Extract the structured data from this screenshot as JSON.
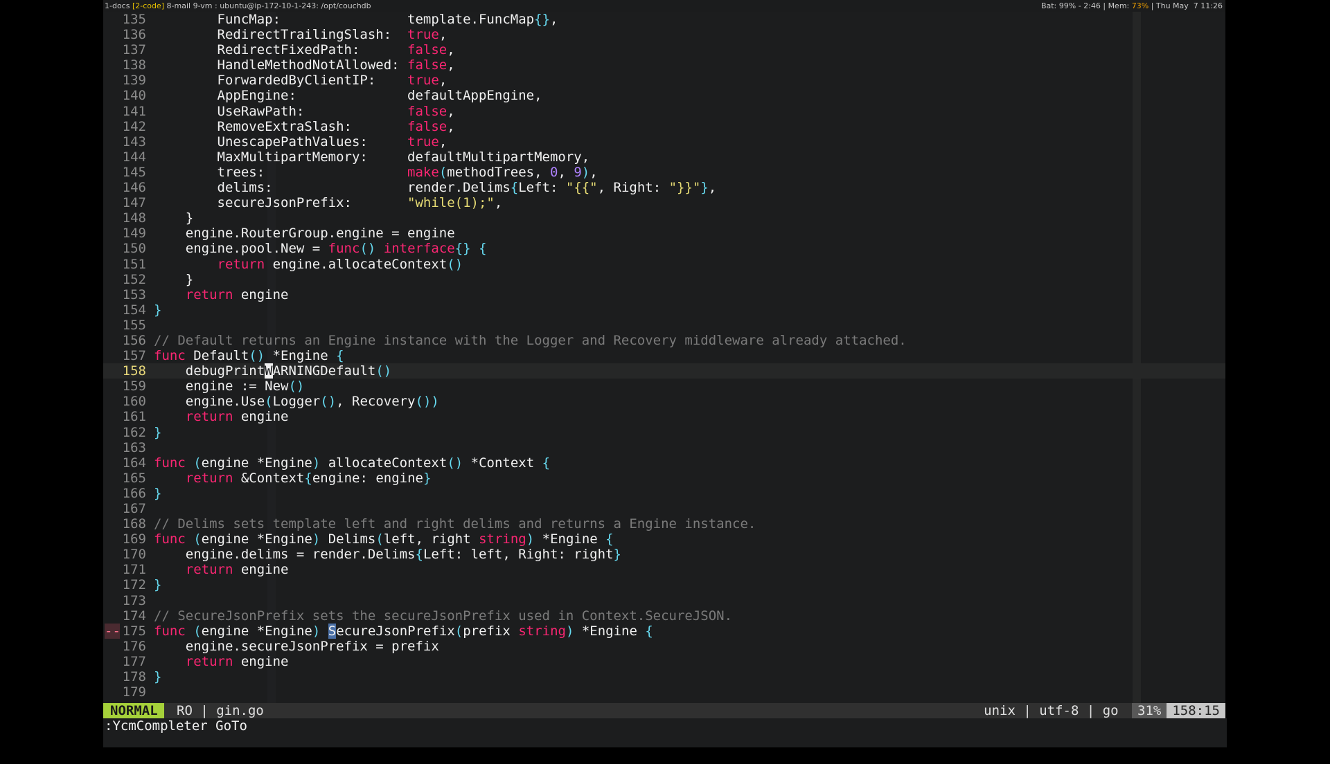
{
  "topbar": {
    "windows_prefix": "1-docs ",
    "active_window": "[2-code]",
    "windows_suffix": " 8-mail 9-vm : ubuntu@ip-172-10-1-243: /opt/couchdb",
    "bat_label": "Bat: 99% - 2:46 | Mem: ",
    "mem_value": "73%",
    "datetime": " | Thu May  7 11:26"
  },
  "editor": {
    "cursor_line": "158",
    "lines": [
      {
        "n": "135",
        "t": [
          [
            "        FuncMap:                ",
            ""
          ],
          [
            "template.FuncMap",
            ""
          ],
          [
            "{}",
            "br"
          ],
          [
            ",",
            ""
          ]
        ]
      },
      {
        "n": "136",
        "t": [
          [
            "        RedirectTrailingSlash:  ",
            ""
          ],
          [
            "true",
            "kw"
          ],
          [
            ",",
            ""
          ]
        ]
      },
      {
        "n": "137",
        "t": [
          [
            "        RedirectFixedPath:      ",
            ""
          ],
          [
            "false",
            "kw"
          ],
          [
            ",",
            ""
          ]
        ]
      },
      {
        "n": "138",
        "t": [
          [
            "        HandleMethodNotAllowed: ",
            ""
          ],
          [
            "false",
            "kw"
          ],
          [
            ",",
            ""
          ]
        ]
      },
      {
        "n": "139",
        "t": [
          [
            "        ForwardedByClientIP:    ",
            ""
          ],
          [
            "true",
            "kw"
          ],
          [
            ",",
            ""
          ]
        ]
      },
      {
        "n": "140",
        "t": [
          [
            "        AppEngine:              defaultAppEngine,",
            ""
          ]
        ]
      },
      {
        "n": "141",
        "t": [
          [
            "        UseRawPath:             ",
            ""
          ],
          [
            "false",
            "kw"
          ],
          [
            ",",
            ""
          ]
        ]
      },
      {
        "n": "142",
        "t": [
          [
            "        RemoveExtraSlash:       ",
            ""
          ],
          [
            "false",
            "kw"
          ],
          [
            ",",
            ""
          ]
        ]
      },
      {
        "n": "143",
        "t": [
          [
            "        UnescapePathValues:     ",
            ""
          ],
          [
            "true",
            "kw"
          ],
          [
            ",",
            ""
          ]
        ]
      },
      {
        "n": "144",
        "t": [
          [
            "        MaxMultipartMemory:     defaultMultipartMemory,",
            ""
          ]
        ]
      },
      {
        "n": "145",
        "t": [
          [
            "        trees:                  ",
            ""
          ],
          [
            "make",
            "kw"
          ],
          [
            "(",
            "br"
          ],
          [
            "methodTrees, ",
            ""
          ],
          [
            "0",
            "num"
          ],
          [
            ", ",
            ""
          ],
          [
            "9",
            "num"
          ],
          [
            ")",
            "br"
          ],
          [
            ",",
            ""
          ]
        ]
      },
      {
        "n": "146",
        "t": [
          [
            "        delims:                 render.Delims",
            ""
          ],
          [
            "{",
            "br"
          ],
          [
            "Left: ",
            ""
          ],
          [
            "\"{{\"",
            "str"
          ],
          [
            ", Right: ",
            ""
          ],
          [
            "\"}}\"",
            "str"
          ],
          [
            "}",
            "br"
          ],
          [
            ",",
            ""
          ]
        ]
      },
      {
        "n": "147",
        "t": [
          [
            "        secureJsonPrefix:       ",
            ""
          ],
          [
            "\"while(1);\"",
            "str"
          ],
          [
            ",",
            ""
          ]
        ]
      },
      {
        "n": "148",
        "t": [
          [
            "    }",
            ""
          ]
        ]
      },
      {
        "n": "149",
        "t": [
          [
            "    engine.RouterGroup.engine = engine",
            ""
          ]
        ]
      },
      {
        "n": "150",
        "t": [
          [
            "    engine.pool.New = ",
            ""
          ],
          [
            "func",
            "kw"
          ],
          [
            "()",
            "br"
          ],
          [
            " ",
            ""
          ],
          [
            "interface",
            "kw"
          ],
          [
            "{}",
            "br"
          ],
          [
            " ",
            ""
          ],
          [
            "{",
            "br"
          ]
        ]
      },
      {
        "n": "151",
        "t": [
          [
            "        ",
            ""
          ],
          [
            "return",
            "kw"
          ],
          [
            " engine.allocateContext",
            ""
          ],
          [
            "()",
            "br"
          ]
        ]
      },
      {
        "n": "152",
        "t": [
          [
            "    }",
            ""
          ]
        ]
      },
      {
        "n": "153",
        "t": [
          [
            "    ",
            ""
          ],
          [
            "return",
            "kw"
          ],
          [
            " engine",
            ""
          ]
        ]
      },
      {
        "n": "154",
        "t": [
          [
            "}",
            "br"
          ]
        ]
      },
      {
        "n": "155",
        "t": []
      },
      {
        "n": "156",
        "t": [
          [
            "// Default returns an Engine instance with the Logger and Recovery middleware already attached.",
            "cm"
          ]
        ]
      },
      {
        "n": "157",
        "t": [
          [
            "func",
            "kw"
          ],
          [
            " Default",
            ""
          ],
          [
            "()",
            "br"
          ],
          [
            " *Engine ",
            ""
          ],
          [
            "{",
            "br"
          ]
        ]
      },
      {
        "n": "158",
        "t": [
          [
            "    debugPrint",
            ""
          ],
          [
            "W",
            "cur"
          ],
          [
            "ARNINGDefault",
            ""
          ],
          [
            "()",
            "br"
          ]
        ]
      },
      {
        "n": "159",
        "t": [
          [
            "    engine := New",
            ""
          ],
          [
            "()",
            "br"
          ]
        ]
      },
      {
        "n": "160",
        "t": [
          [
            "    engine.Use",
            ""
          ],
          [
            "(",
            "br"
          ],
          [
            "Logger",
            ""
          ],
          [
            "()",
            "br"
          ],
          [
            ", Recovery",
            ""
          ],
          [
            "())",
            "br"
          ]
        ]
      },
      {
        "n": "161",
        "t": [
          [
            "    ",
            ""
          ],
          [
            "return",
            "kw"
          ],
          [
            " engine",
            ""
          ]
        ]
      },
      {
        "n": "162",
        "t": [
          [
            "}",
            "br"
          ]
        ]
      },
      {
        "n": "163",
        "t": []
      },
      {
        "n": "164",
        "t": [
          [
            "func",
            "kw"
          ],
          [
            " ",
            ""
          ],
          [
            "(",
            "br"
          ],
          [
            "engine *Engine",
            ""
          ],
          [
            ")",
            "br"
          ],
          [
            " allocateContext",
            ""
          ],
          [
            "()",
            "br"
          ],
          [
            " *Context ",
            ""
          ],
          [
            "{",
            "br"
          ]
        ]
      },
      {
        "n": "165",
        "t": [
          [
            "    ",
            ""
          ],
          [
            "return",
            "kw"
          ],
          [
            " &Context",
            ""
          ],
          [
            "{",
            "br"
          ],
          [
            "engine: engine",
            ""
          ],
          [
            "}",
            "br"
          ]
        ]
      },
      {
        "n": "166",
        "t": [
          [
            "}",
            "br"
          ]
        ]
      },
      {
        "n": "167",
        "t": []
      },
      {
        "n": "168",
        "t": [
          [
            "// Delims sets template left and right delims and returns a Engine instance.",
            "cm"
          ]
        ]
      },
      {
        "n": "169",
        "t": [
          [
            "func",
            "kw"
          ],
          [
            " ",
            ""
          ],
          [
            "(",
            "br"
          ],
          [
            "engine *Engine",
            ""
          ],
          [
            ")",
            "br"
          ],
          [
            " Delims",
            ""
          ],
          [
            "(",
            "br"
          ],
          [
            "left, right ",
            ""
          ],
          [
            "string",
            "kw"
          ],
          [
            ")",
            "br"
          ],
          [
            " *Engine ",
            ""
          ],
          [
            "{",
            "br"
          ]
        ]
      },
      {
        "n": "170",
        "t": [
          [
            "    engine.delims = render.Delims",
            ""
          ],
          [
            "{",
            "br"
          ],
          [
            "Left: left, Right: right",
            ""
          ],
          [
            "}",
            "br"
          ]
        ]
      },
      {
        "n": "171",
        "t": [
          [
            "    ",
            ""
          ],
          [
            "return",
            "kw"
          ],
          [
            " engine",
            ""
          ]
        ]
      },
      {
        "n": "172",
        "t": [
          [
            "}",
            "br"
          ]
        ]
      },
      {
        "n": "173",
        "t": []
      },
      {
        "n": "174",
        "t": [
          [
            "// SecureJsonPrefix sets the secureJsonPrefix used in Context.SecureJSON.",
            "cm"
          ]
        ]
      },
      {
        "n": "175",
        "sign": "--",
        "t": [
          [
            "func",
            "kw"
          ],
          [
            " ",
            ""
          ],
          [
            "(",
            "br"
          ],
          [
            "engine *Engine",
            ""
          ],
          [
            ")",
            "br"
          ],
          [
            " ",
            ""
          ],
          [
            "S",
            "match"
          ],
          [
            "ecureJsonPrefix",
            ""
          ],
          [
            "(",
            "br"
          ],
          [
            "prefix ",
            ""
          ],
          [
            "string",
            "kw"
          ],
          [
            ")",
            "br"
          ],
          [
            " *Engine ",
            ""
          ],
          [
            "{",
            "br"
          ]
        ]
      },
      {
        "n": "176",
        "t": [
          [
            "    engine.secureJsonPrefix = prefix",
            ""
          ]
        ]
      },
      {
        "n": "177",
        "t": [
          [
            "    ",
            ""
          ],
          [
            "return",
            "kw"
          ],
          [
            " engine",
            ""
          ]
        ]
      },
      {
        "n": "178",
        "t": [
          [
            "}",
            "br"
          ]
        ]
      },
      {
        "n": "179",
        "t": []
      }
    ]
  },
  "statusline": {
    "mode": "NORMAL",
    "left": "RO | gin.go",
    "right": "unix | utf-8 | go ",
    "percent": "31%",
    "position": "158:15"
  },
  "command_line": ":YcmCompleter GoTo",
  "colors": {
    "keyword": "#f92672",
    "string": "#e6db74",
    "number": "#ae81ff",
    "comment": "#7a7a7a",
    "bracket": "#66d9ef",
    "mode_bg": "#a6d13a"
  }
}
